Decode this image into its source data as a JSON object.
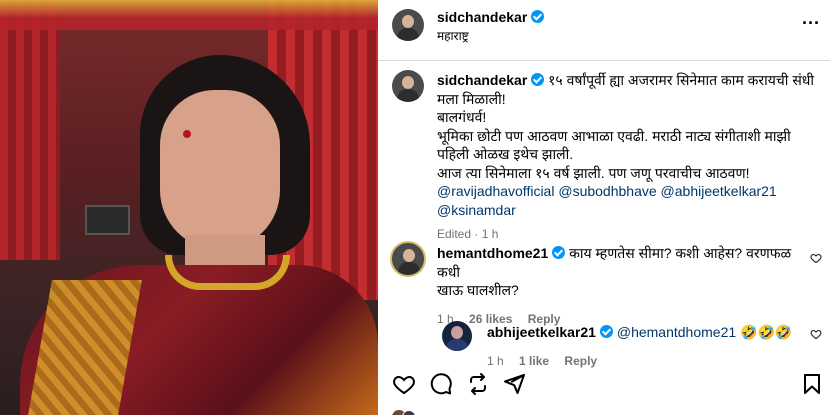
{
  "post": {
    "author": "sidchandekar",
    "location": "महाराष्ट्र",
    "caption": {
      "author": "sidchandekar",
      "line1": "१५ वर्षांपूर्वी ह्या अजरामर सिनेमात काम करायची संधी",
      "line2": "मला मिळाली!",
      "line3": "बालगंधर्व!",
      "line4": "भूमिका छोटी पण आठवण आभाळा एवढी. मराठी नाट्य संगीताशी माझी",
      "line5": "पहिली ओळख इथेच झाली.",
      "line6": "आज त्या सिनेमाला १५ वर्ष झाली. पण जणू परवाचीच आठवण!",
      "mentions": [
        "@ravijadhavofficial",
        "@subodhbhave",
        "@abhijeetkelkar21",
        "@ksinamdar"
      ],
      "edited": "Edited",
      "time": "1 h"
    }
  },
  "comments": [
    {
      "author": "hemantdhome21",
      "text_line1": "काय म्हणतेस सीमा? कशी आहेस? वरणफळ कधी",
      "text_line2": "खाऊ घालशील?",
      "time": "1 h",
      "likes": "26 likes",
      "reply": "Reply"
    },
    {
      "author": "abhijeetkelkar21",
      "mention": "@hemantdhome21",
      "emojis": "🤣🤣🤣",
      "time": "1 h",
      "likes": "1 like",
      "reply": "Reply"
    }
  ],
  "icons": {
    "more": "more-options-icon",
    "like": "heart-icon",
    "comment": "comment-icon",
    "share": "repost-icon",
    "send": "send-icon",
    "save": "bookmark-icon"
  },
  "colors": {
    "verified": "#0095f6",
    "mention": "#00376b",
    "meta": "#737373"
  }
}
